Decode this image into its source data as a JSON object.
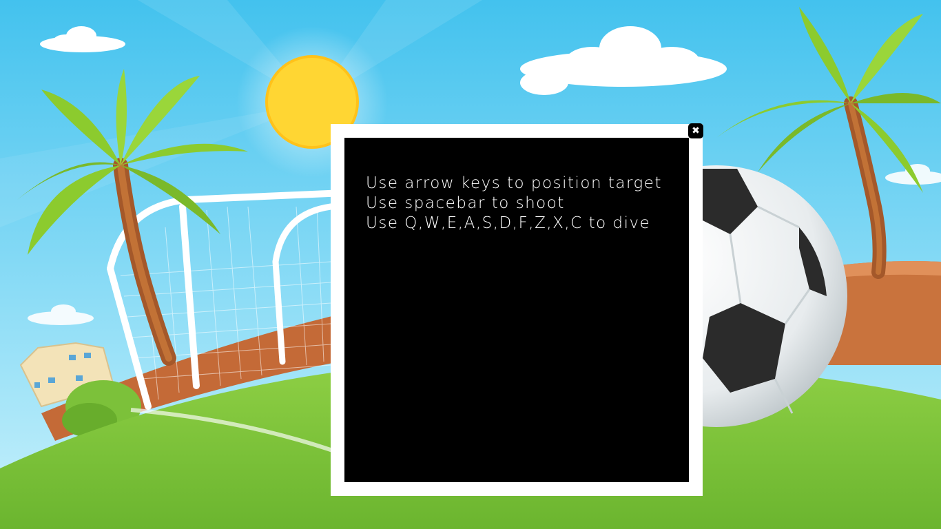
{
  "colors": {
    "sky_top": "#4cc6ee",
    "sky_bottom": "#bfeefb",
    "sun": "#ffd633",
    "grass": "#7cc13a",
    "grass_dark": "#5ea52a",
    "dirt": "#c9733d",
    "modal_frame": "#ffffff",
    "modal_panel": "#000000",
    "text": "#ffffff"
  },
  "dialog": {
    "instructions": [
      "Use arrow keys to position target",
      "Use spacebar to shoot",
      "Use Q,W,E,A,S,D,F,Z,X,C to dive"
    ],
    "close_icon": "close-icon",
    "close_glyph": "✖"
  }
}
